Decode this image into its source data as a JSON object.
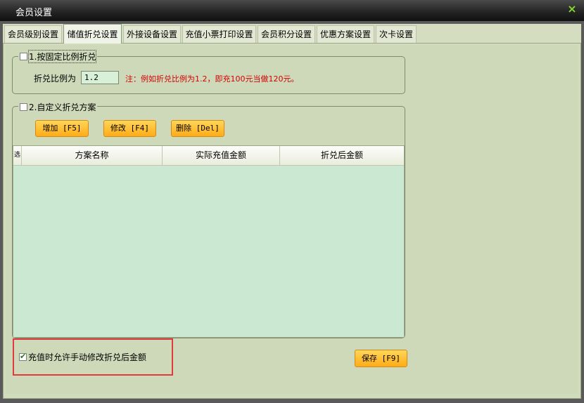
{
  "window": {
    "title": "会员设置",
    "close_icon": "×"
  },
  "tabs": [
    {
      "label": "会员级别设置"
    },
    {
      "label": "储值折兑设置"
    },
    {
      "label": "外接设备设置"
    },
    {
      "label": "充值小票打印设置"
    },
    {
      "label": "会员积分设置"
    },
    {
      "label": "优惠方案设置"
    },
    {
      "label": "次卡设置"
    }
  ],
  "group1": {
    "checkbox_label": "1.按固定比例折兑",
    "ratio_label": "折兑比例为",
    "ratio_value": "1.2",
    "note": "注：例如折兑比例为1.2，即充100元当做120元。"
  },
  "group2": {
    "checkbox_label": "2.自定义折兑方案",
    "buttons": {
      "add": "增加 [F5]",
      "edit": "修改 [F4]",
      "delete": "删除 [Del]"
    },
    "table": {
      "row_header": "选",
      "columns": [
        "方案名称",
        "实际充值金额",
        "折兑后金额"
      ]
    }
  },
  "bottom": {
    "allow_manual_label": "充值时允许手动修改折兑后金额",
    "save_button": "保存 [F9]"
  }
}
